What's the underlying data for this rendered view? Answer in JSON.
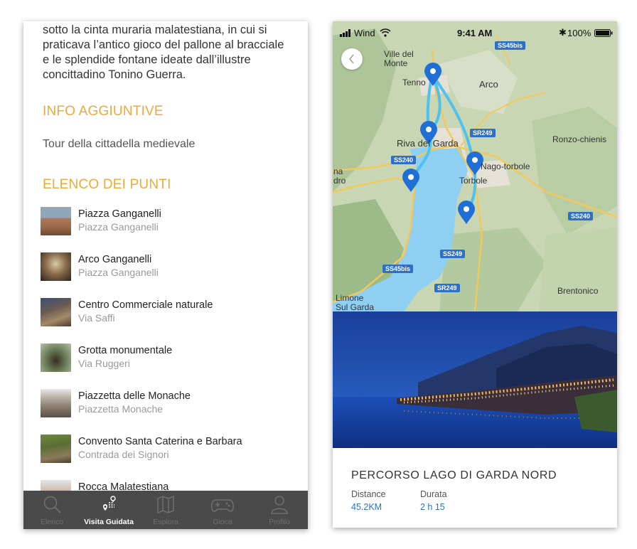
{
  "left_screen": {
    "intro_lines": [
      "sotto la cinta muraria malatestiana, in cui si",
      "praticava l’antico gioco del pallone al bracciale",
      "e le splendide fontane ideate dall’illustre",
      "concittadino Tonino Guerra."
    ],
    "info_title": "INFO AGGIUNTIVE",
    "info_text": "Tour della cittadella medievale",
    "points_title": "ELENCO DEI PUNTI",
    "points": [
      {
        "name": "Piazza Ganganelli",
        "address": "Piazza Ganganelli"
      },
      {
        "name": "Arco Ganganelli",
        "address": "Piazza Ganganelli"
      },
      {
        "name": "Centro Commerciale naturale",
        "address": "Via Saffi"
      },
      {
        "name": "Grotta monumentale",
        "address": "Via Ruggeri"
      },
      {
        "name": "Piazzetta delle Monache",
        "address": "Piazzetta Monache"
      },
      {
        "name": "Convento Santa Caterina e Barbara",
        "address": "Contrada dei Signori"
      },
      {
        "name": "Rocca Malatestiana",
        "address": ""
      }
    ],
    "tabs": [
      {
        "label": "Elenco",
        "icon": "search-icon"
      },
      {
        "label": "Visita Guidata",
        "icon": "route-pin-icon"
      },
      {
        "label": "Esplora",
        "icon": "map-icon"
      },
      {
        "label": "Gioca",
        "icon": "gamepad-icon"
      },
      {
        "label": "Profilo",
        "icon": "user-icon"
      }
    ],
    "active_tab": "Visita Guidata",
    "colors": {
      "accent": "#efa93a",
      "tabbar": "#4a4a4a"
    }
  },
  "right_screen": {
    "status": {
      "carrier": "Wind",
      "time": "9:41 AM",
      "battery": "100%"
    },
    "map_labels": {
      "ville": "Ville del",
      "monte": "Monte",
      "tenno": "Tenno",
      "arco": "Arco",
      "riva": "Riva del Garda",
      "nago": "Nago-torbole",
      "torbole": "Torbole",
      "ronzo": "Ronzo-chienis",
      "brentonico": "Brentonico",
      "limone": "Limone",
      "sulgarda": "Sul Garda",
      "na": "na",
      "dro": "dro"
    },
    "road_labels": {
      "ss45bis_top": "SS45bis",
      "sr249_top": "SR249",
      "ss240_left": "SS240",
      "ss240_right": "SS240",
      "ss249": "SS249",
      "ss45bis_bottom": "SS45bis",
      "sr249_bottom": "SR249"
    },
    "route": {
      "title": "PERCORSO LAGO DI GARDA NORD",
      "distance_label": "Distance",
      "distance_value": "45.2KM",
      "duration_label": "Durata",
      "duration_value": "2 h 15"
    },
    "colors": {
      "route": "#4fc1ee",
      "pin": "#1f6fd6",
      "lake": "#8ecff2",
      "link": "#2f72c2"
    }
  }
}
